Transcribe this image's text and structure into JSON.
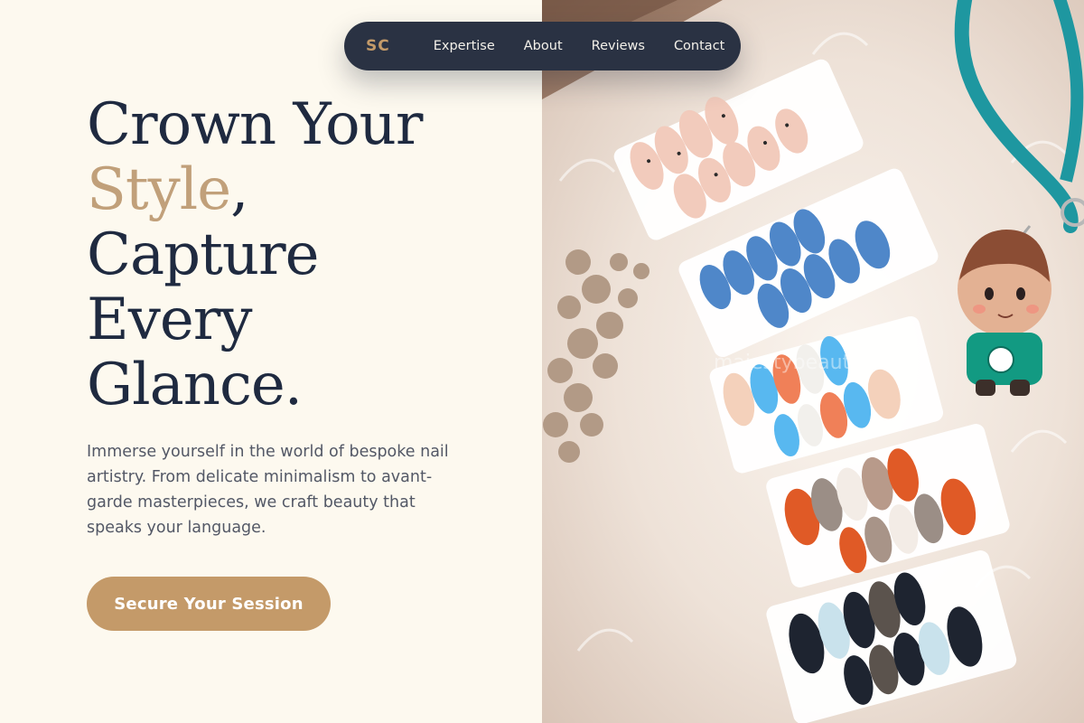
{
  "nav": {
    "logo": "SC",
    "links": [
      "Expertise",
      "About",
      "Reviews",
      "Contact"
    ]
  },
  "hero": {
    "headline_1": "Crown Your",
    "headline_accent": "Style",
    "headline_comma": ",",
    "headline_2": "Capture",
    "headline_3": "Every",
    "headline_4": "Glance.",
    "lead": "Immerse yourself in the world of bespoke nail artistry. From delicate minimalism to avant-garde masterpieces, we craft beauty that speaks your language.",
    "cta_label": "Secure Your Session"
  },
  "image": {
    "watermark": "majestybeauty",
    "alt": "Press-on nail sets displayed on white fur with a keychain figure"
  },
  "colors": {
    "background": "#fdf9ef",
    "navy": "#2a3243",
    "accent": "#c49a69",
    "heading": "#1f2a40",
    "body_text": "#535866"
  }
}
